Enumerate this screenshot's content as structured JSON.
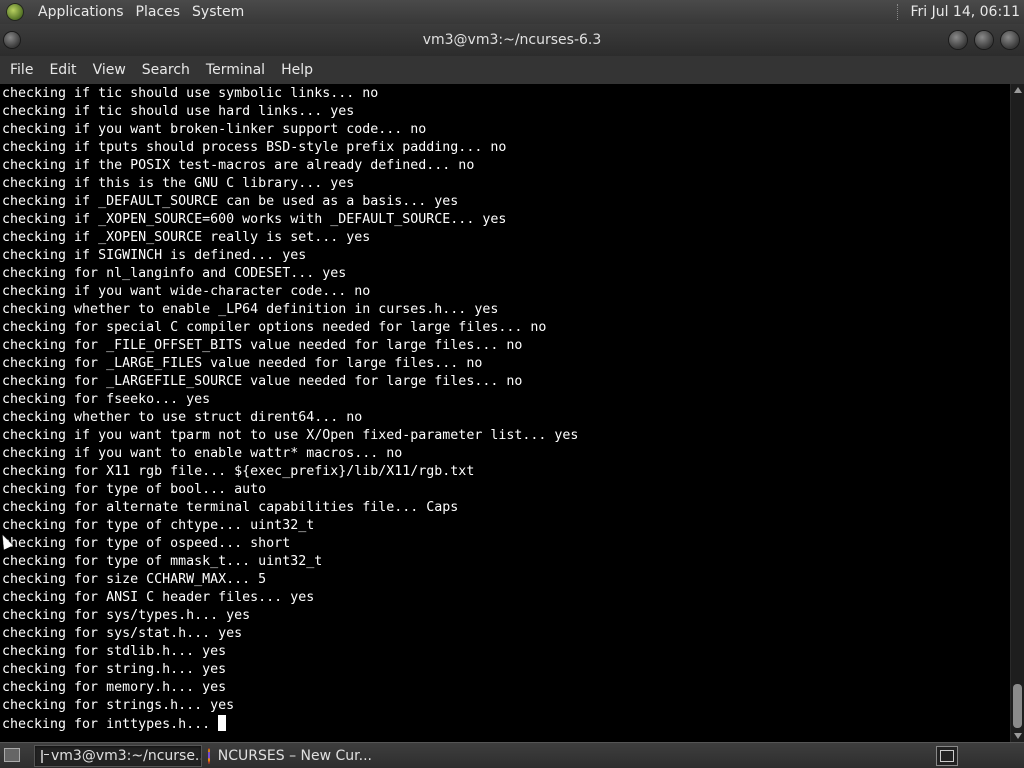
{
  "top_panel": {
    "menus": [
      "Applications",
      "Places",
      "System"
    ],
    "clock": "Fri Jul 14, 06:11"
  },
  "window": {
    "title": "vm3@vm3:~/ncurses-6.3"
  },
  "menubar": {
    "items": [
      "File",
      "Edit",
      "View",
      "Search",
      "Terminal",
      "Help"
    ]
  },
  "terminal": {
    "lines": [
      "checking if tic should use symbolic links... no",
      "checking if tic should use hard links... yes",
      "checking if you want broken-linker support code... no",
      "checking if tputs should process BSD-style prefix padding... no",
      "checking if the POSIX test-macros are already defined... no",
      "checking if this is the GNU C library... yes",
      "checking if _DEFAULT_SOURCE can be used as a basis... yes",
      "checking if _XOPEN_SOURCE=600 works with _DEFAULT_SOURCE... yes",
      "checking if _XOPEN_SOURCE really is set... yes",
      "checking if SIGWINCH is defined... yes",
      "checking for nl_langinfo and CODESET... yes",
      "checking if you want wide-character code... no",
      "checking whether to enable _LP64 definition in curses.h... yes",
      "checking for special C compiler options needed for large files... no",
      "checking for _FILE_OFFSET_BITS value needed for large files... no",
      "checking for _LARGE_FILES value needed for large files... no",
      "checking for _LARGEFILE_SOURCE value needed for large files... no",
      "checking for fseeko... yes",
      "checking whether to use struct dirent64... no",
      "checking if you want tparm not to use X/Open fixed-parameter list... yes",
      "checking if you want to enable wattr* macros... no",
      "checking for X11 rgb file... ${exec_prefix}/lib/X11/rgb.txt",
      "checking for type of bool... auto",
      "checking for alternate terminal capabilities file... Caps",
      "checking for type of chtype... uint32_t",
      "checking for type of ospeed... short",
      "checking for type of mmask_t... uint32_t",
      "checking for size CCHARW_MAX... 5",
      "checking for ANSI C header files... yes",
      "checking for sys/types.h... yes",
      "checking for sys/stat.h... yes",
      "checking for stdlib.h... yes",
      "checking for string.h... yes",
      "checking for memory.h... yes",
      "checking for strings.h... yes"
    ],
    "current_line": "checking for inttypes.h... "
  },
  "taskbar": {
    "tasks": [
      {
        "label": "vm3@vm3:~/ncurse...",
        "icon": "terminal-icon",
        "active": true
      },
      {
        "label": "NCURSES – New Cur...",
        "icon": "firefox-icon",
        "active": false
      }
    ]
  }
}
